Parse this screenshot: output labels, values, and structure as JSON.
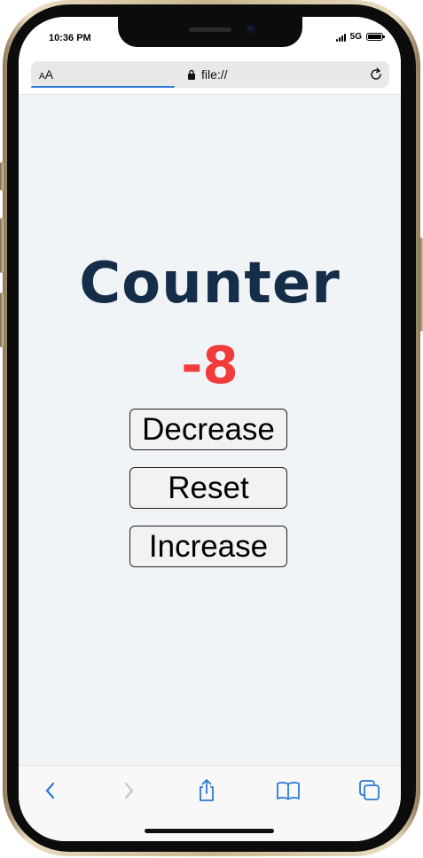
{
  "status": {
    "time": "10:36 PM",
    "network": "5G"
  },
  "browser": {
    "text_size_label_small": "A",
    "text_size_label_large": "A",
    "url": "file://",
    "progress_fraction": 0.4
  },
  "counter": {
    "title": "Counter",
    "value": "-8",
    "value_color": "#f23b3b"
  },
  "buttons": {
    "decrease": "Decrease",
    "reset": "Reset",
    "increase": "Increase"
  },
  "toolbar": {
    "icons": [
      "back-icon",
      "forward-icon",
      "share-icon",
      "bookmarks-icon",
      "tabs-icon"
    ]
  }
}
